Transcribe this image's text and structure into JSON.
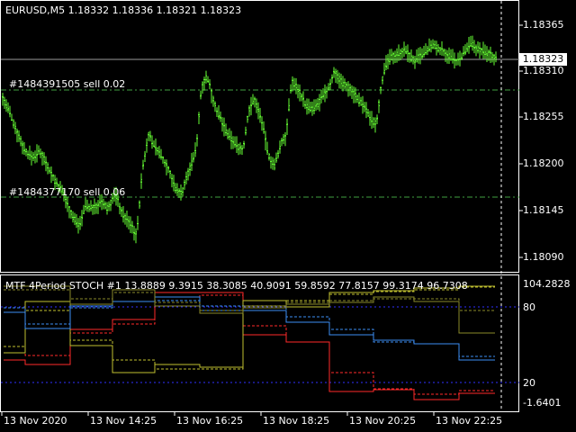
{
  "main_pane": {
    "symbol_label": "EURUSD,M5  1.18332 1.18336 1.18321 1.18323",
    "current_price": "1.18323",
    "price_axis": [
      "1.18365",
      "1.18310",
      "1.18255",
      "1.18200",
      "1.18145",
      "1.18090"
    ],
    "orders": [
      {
        "label": "#1484391505 sell 0.02"
      },
      {
        "label": "#1484377170 sell 0.06"
      }
    ],
    "colors": {
      "candles": "#66ff33",
      "grid": "#ffffff",
      "order_line": "#4caf50",
      "bid_line": "#c0c0c0",
      "axis": "#ffffff"
    }
  },
  "indicator_pane": {
    "label": "MTF 4Period STOCH #1  13.8889 9.3915 38.3085 40.9091 59.8592 77.8157 99.3174 96.7308",
    "axis": [
      "104.2828",
      "80",
      "20",
      "-1.6401"
    ],
    "colors": {
      "red": "#ff2a2a",
      "yellow": "#b5b52d",
      "blue": "#3d8ef5",
      "olive": "#8a8a2a",
      "level": "#3030ff"
    }
  },
  "time_axis": [
    "13 Nov 2020",
    "13 Nov 14:25",
    "13 Nov 16:25",
    "13 Nov 18:25",
    "13 Nov 20:25",
    "13 Nov 22:25"
  ]
}
